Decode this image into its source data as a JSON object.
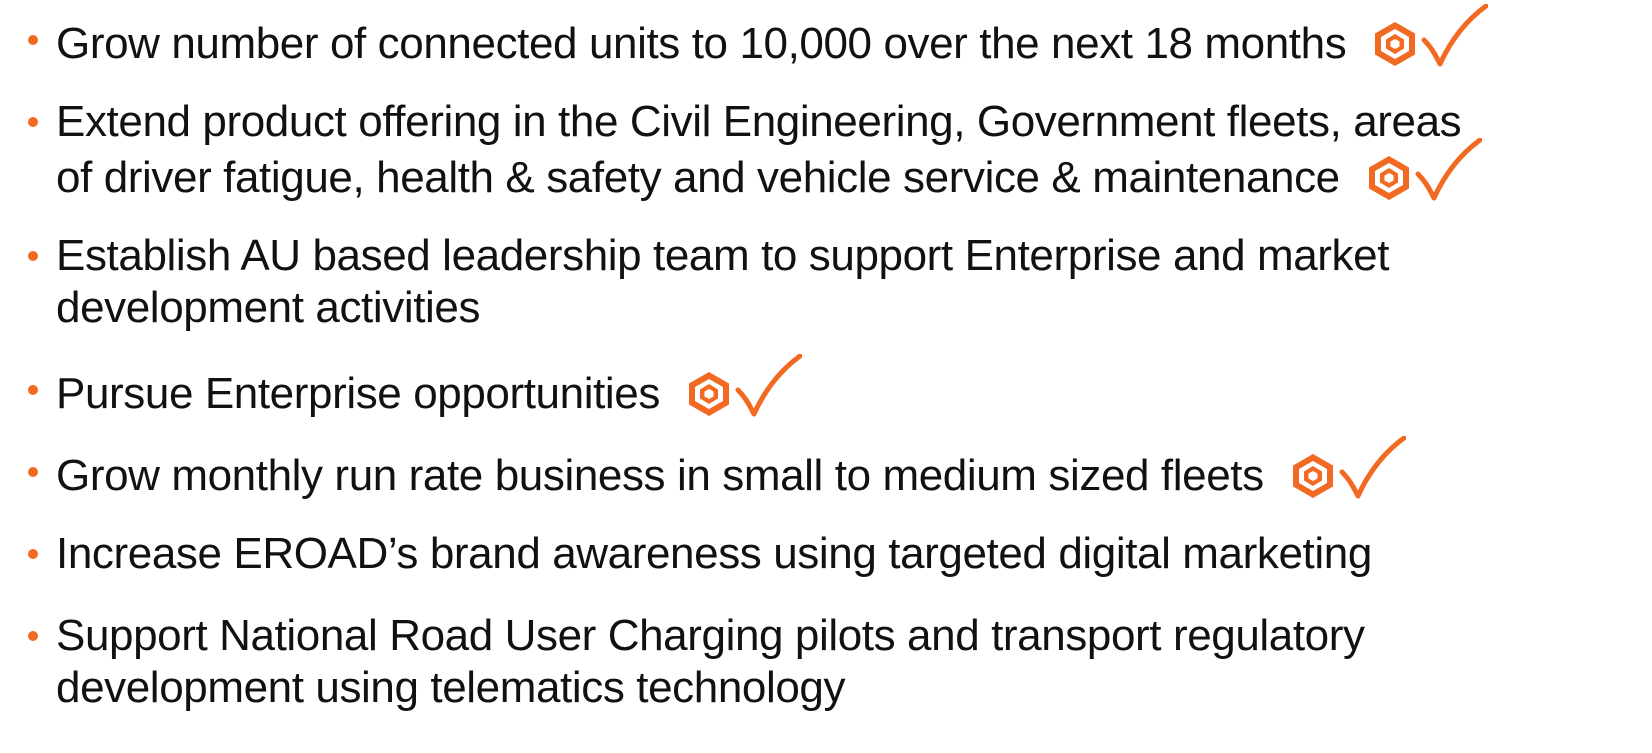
{
  "brand": {
    "accent": "#f26a21",
    "accent_dark": "#d9521a",
    "text_color": "#111111"
  },
  "bullets": [
    {
      "lines": [
        "Grow number of connected units to 10,000 over the next 18 months"
      ],
      "achieved": true,
      "icons": [
        "eroad-logo-icon",
        "checkmark-icon"
      ]
    },
    {
      "lines": [
        "Extend product offering in the Civil Engineering,  Government fleets, areas",
        "of driver fatigue, health & safety and vehicle service & maintenance"
      ],
      "achieved": true,
      "icons": [
        "eroad-logo-icon",
        "checkmark-icon"
      ]
    },
    {
      "lines": [
        "Establish AU based leadership team to support Enterprise and market",
        "development activities"
      ],
      "achieved": false
    },
    {
      "lines": [
        "Pursue Enterprise opportunities"
      ],
      "achieved": true,
      "icons": [
        "eroad-logo-icon",
        "checkmark-icon"
      ]
    },
    {
      "lines": [
        "Grow monthly run rate business in small to medium sized fleets"
      ],
      "achieved": true,
      "icons": [
        "eroad-logo-icon",
        "checkmark-icon"
      ]
    },
    {
      "lines": [
        "Increase EROAD’s brand awareness using targeted digital marketing"
      ],
      "achieved": false
    },
    {
      "lines": [
        "Support National Road User Charging pilots and transport regulatory",
        "development using telematics technology"
      ],
      "achieved": false
    }
  ]
}
